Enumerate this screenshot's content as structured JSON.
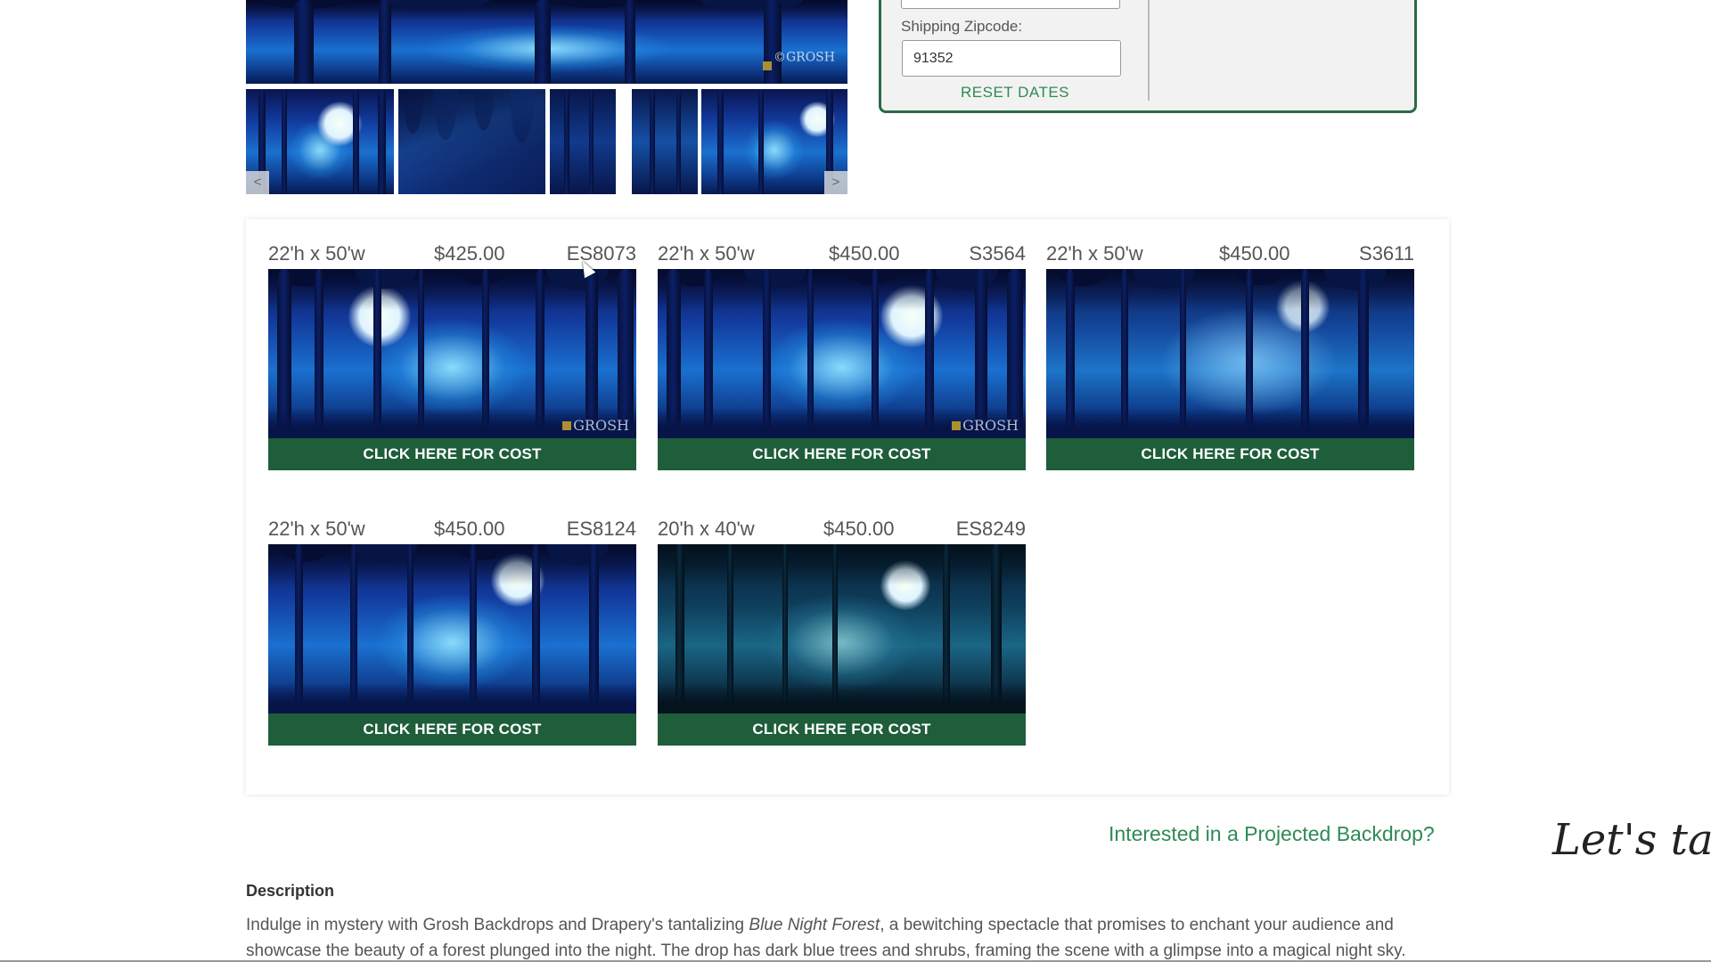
{
  "gallery": {
    "watermark": "GROSH",
    "prev_label": "<",
    "next_label": ">"
  },
  "booking": {
    "zip_label": "Shipping Zipcode:",
    "zip_value": "91352",
    "reset_label": "RESET DATES"
  },
  "products": [
    {
      "size": "22'h x 50'w",
      "price": "$425.00",
      "sku": "ES8073",
      "cta": "CLICK HERE FOR COST",
      "watermark": "GROSH"
    },
    {
      "size": "22'h x 50'w",
      "price": "$450.00",
      "sku": "S3564",
      "cta": "CLICK HERE FOR COST",
      "watermark": "GROSH"
    },
    {
      "size": "22'h x 50'w",
      "price": "$450.00",
      "sku": "S3611",
      "cta": "CLICK HERE FOR COST"
    },
    {
      "size": "22'h x 50'w",
      "price": "$450.00",
      "sku": "ES8124",
      "cta": "CLICK HERE FOR COST"
    },
    {
      "size": "20'h x 40'w",
      "price": "$450.00",
      "sku": "ES8249",
      "cta": "CLICK HERE FOR COST"
    }
  ],
  "projected_link": "Interested in a Projected Backdrop?",
  "lets_talk": "Let's talk...",
  "description": {
    "heading": "Description",
    "text_before": "Indulge in mystery with Grosh Backdrops and Drapery's tantalizing ",
    "title": "Blue Night Forest",
    "text_after": ", a bewitching spectacle that promises to enchant your audience and showcase the beauty of a forest plunged into the night. The drop has dark blue trees and shrubs, framing the scene with a glimpse into a magical night sky."
  },
  "colors": {
    "brand_green": "#1f5e3b",
    "link_green": "#2e8a55"
  }
}
